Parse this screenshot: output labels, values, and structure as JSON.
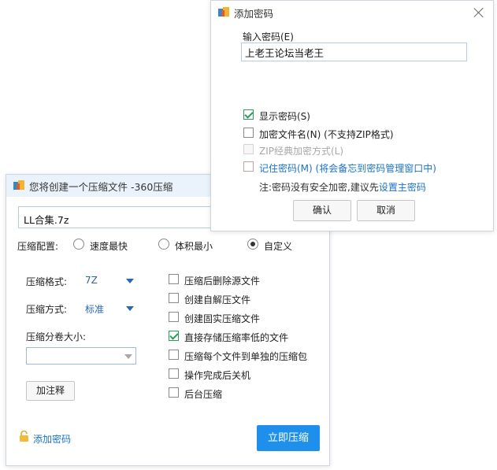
{
  "compress_dialog": {
    "title": "您将创建一个压缩文件 -360压缩",
    "filename": "LL合集.7z",
    "config_label": "压缩配置:",
    "config_options": [
      "速度最快",
      "体积最小",
      "自定义"
    ],
    "config_selected": "自定义",
    "format_label": "压缩格式:",
    "format_value": "7Z",
    "method_label": "压缩方式:",
    "method_value": "标准",
    "split_label": "压缩分卷大小:",
    "split_value": "",
    "comment_button": "加注释",
    "options": [
      {
        "label": "压缩后删除源文件",
        "checked": false
      },
      {
        "label": "创建自解压文件",
        "checked": false
      },
      {
        "label": "创建固实压缩文件",
        "checked": false
      },
      {
        "label": "直接存储压缩率低的文件",
        "checked": true
      },
      {
        "label": "压缩每个文件到单独的压缩包",
        "checked": false
      },
      {
        "label": "操作完成后关机",
        "checked": false
      },
      {
        "label": "后台压缩",
        "checked": false
      }
    ],
    "add_password_link": "添加密码",
    "compress_button": "立即压缩"
  },
  "password_dialog": {
    "title": "添加密码",
    "input_label": "输入密码(E)",
    "password_value": "上老王论坛当老王",
    "show_password": {
      "label": "显示密码(S)",
      "checked": true
    },
    "encrypt_filenames": {
      "label": "加密文件名(N) (不支持ZIP格式)",
      "checked": false
    },
    "zip_classic": {
      "label": "ZIP经典加密方式(L)",
      "checked": false
    },
    "remember": {
      "label": "记住密码(M) (将会备忘到密码管理窗口中)",
      "checked": false
    },
    "note_prefix": "注:密码没有安全加密,建议先",
    "note_link": "设置主密码",
    "ok_button": "确认",
    "cancel_button": "取消"
  },
  "colors": {
    "accent": "#1e90ec",
    "link": "#1a73c9",
    "titlebar": "#eaf3fb",
    "check_green": "#2e9b5b"
  }
}
